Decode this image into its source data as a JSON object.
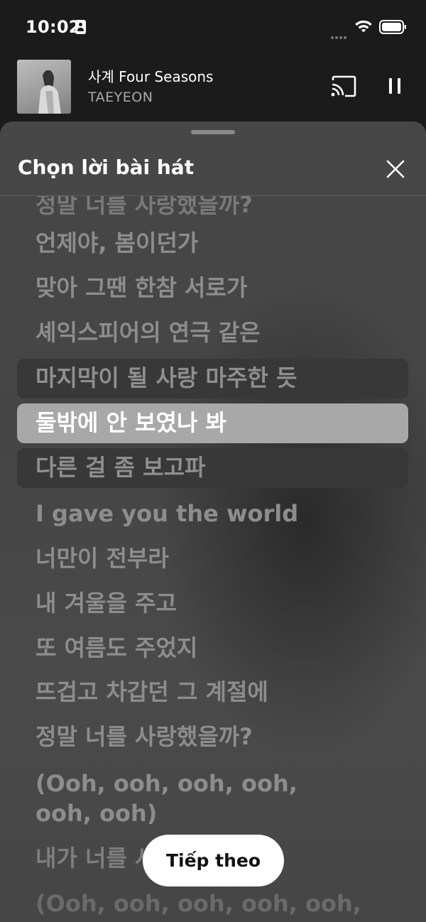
{
  "status_bar": {
    "time": "10:02"
  },
  "mini_player": {
    "track_title": "사계 Four Seasons",
    "artist": "TAEYEON"
  },
  "sheet": {
    "title": "Chọn lời bài hát",
    "next_button": "Tiếp theo"
  },
  "lyrics": [
    "정말 너를 사랑했을까?",
    "언제야, 봄이던가",
    "맞아 그땐 한참 서로가",
    "셰익스피어의 연극 같은",
    "마지막이 될 사랑 마주한 듯",
    "둘밖에 안 보였나 봐",
    "다른 걸 좀 보고파",
    "I gave you the world",
    "너만이 전부라",
    "내 겨울을 주고",
    "또 여름도 주었지",
    "뜨겁고 차갑던 그 계절에",
    "정말 너를 사랑했을까?",
    "(Ooh, ooh, ooh, ooh, ooh, ooh)",
    "내가 너를 사랑했을까?",
    "(Ooh, ooh, ooh, ooh, ooh,"
  ]
}
